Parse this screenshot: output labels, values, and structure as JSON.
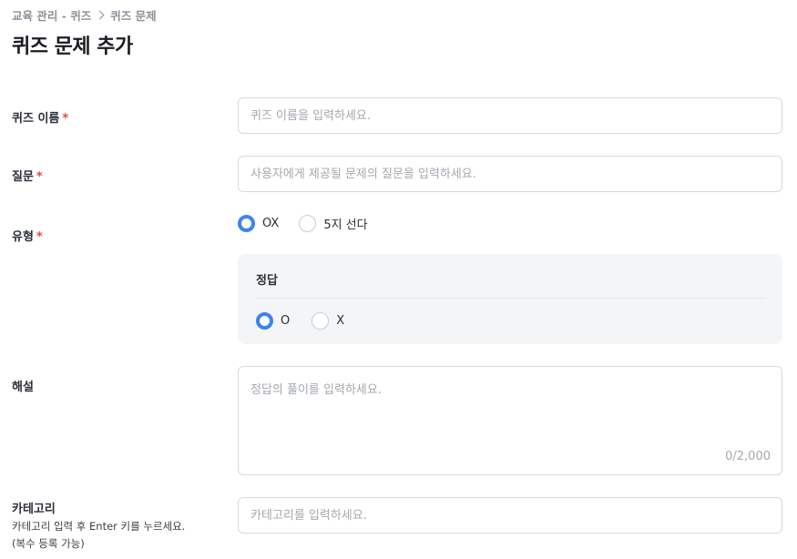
{
  "breadcrumb": {
    "parent": "교육 관리 - 퀴즈",
    "current": "퀴즈 문제"
  },
  "page_title": "퀴즈 문제 추가",
  "form": {
    "quiz_name": {
      "label": "퀴즈 이름",
      "required_mark": "*",
      "placeholder": "퀴즈 이름을 입력하세요.",
      "value": ""
    },
    "question": {
      "label": "질문",
      "required_mark": "*",
      "placeholder": "사용자에게 제공될 문제의 질문을 입력하세요.",
      "value": ""
    },
    "type": {
      "label": "유형",
      "required_mark": "*",
      "options": [
        {
          "label": "OX",
          "checked": true
        },
        {
          "label": "5지 선다",
          "checked": false
        }
      ]
    },
    "answer": {
      "title": "정답",
      "options": [
        {
          "label": "O",
          "checked": true
        },
        {
          "label": "X",
          "checked": false
        }
      ]
    },
    "explanation": {
      "label": "해설",
      "placeholder": "정답의 풀이를 입력하세요.",
      "counter": "0/2,000"
    },
    "category": {
      "label": "카테고리",
      "hint_line1": "카테고리 입력 후 Enter 키를 누르세요.",
      "hint_line2": "(복수 등록 가능)",
      "placeholder": "카테고리를 입력하세요.",
      "value": ""
    }
  },
  "colors": {
    "accent": "#3b82f6",
    "required": "#e5483d",
    "panel_bg": "#f4f5f7"
  }
}
